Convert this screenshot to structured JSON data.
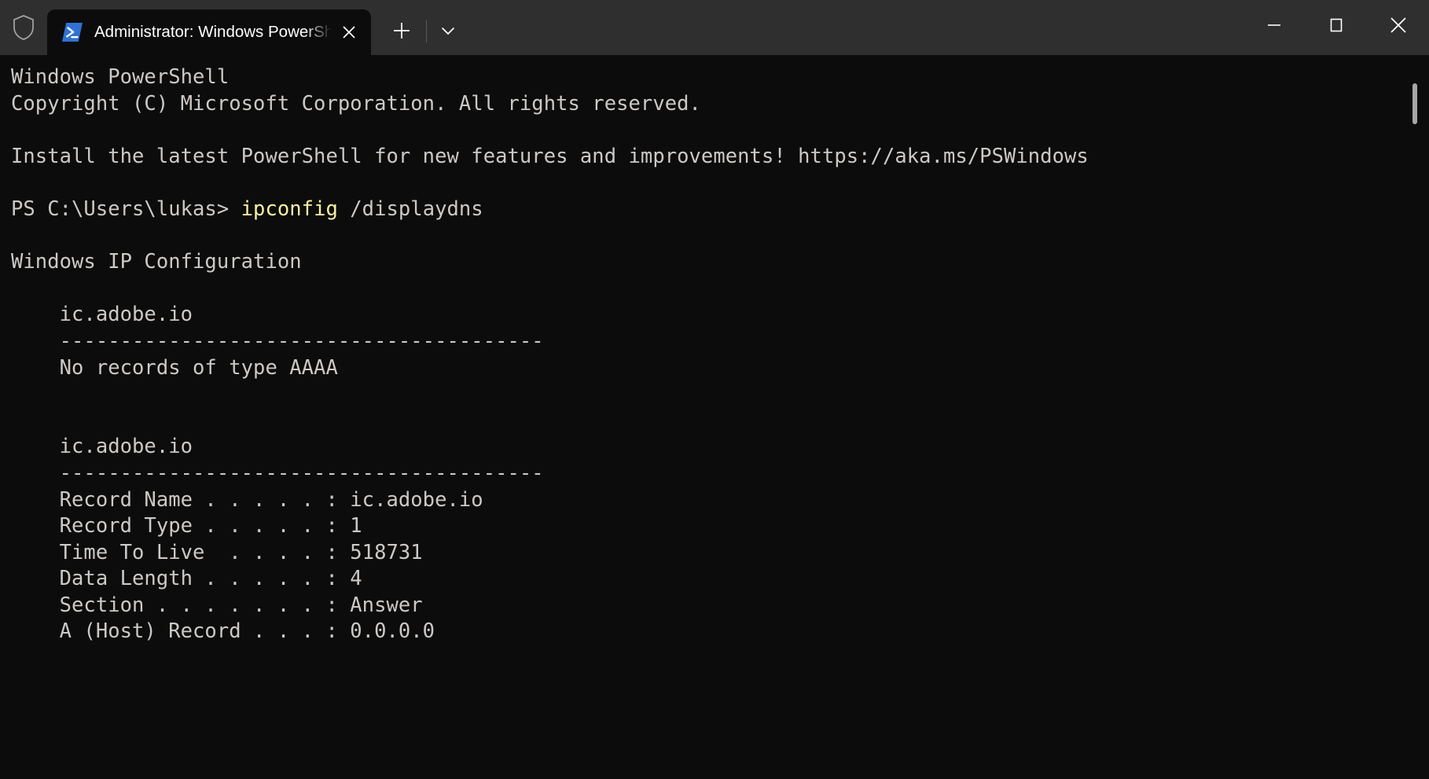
{
  "window": {
    "titlebar": {
      "shield_icon": "shield-icon",
      "minimize_label": "—",
      "maximize_label": "□",
      "close_label": "✕",
      "newtab_label": "+",
      "dropdown_label": "⌄"
    },
    "tabs": [
      {
        "icon": "powershell-icon",
        "title": "Administrator: Windows PowerShell",
        "close_label": "✕",
        "active": true
      }
    ]
  },
  "terminal": {
    "colors": {
      "background": "#0c0c0c",
      "foreground": "#ccc9c6",
      "command_accent": "#f9f1a5",
      "titlebar": "#2f2f2f"
    },
    "lines": [
      {
        "text": "Windows PowerShell"
      },
      {
        "text": "Copyright (C) Microsoft Corporation. All rights reserved."
      },
      {
        "text": ""
      },
      {
        "text": "Install the latest PowerShell for new features and improvements! https://aka.ms/PSWindows"
      },
      {
        "text": ""
      },
      {
        "prompt": "PS C:\\Users\\lukas> ",
        "command": "ipconfig",
        "args": " /displaydns"
      },
      {
        "text": ""
      },
      {
        "text": "Windows IP Configuration"
      },
      {
        "text": ""
      },
      {
        "text": "    ic.adobe.io"
      },
      {
        "text": "    ----------------------------------------"
      },
      {
        "text": "    No records of type AAAA"
      },
      {
        "text": ""
      },
      {
        "text": ""
      },
      {
        "text": "    ic.adobe.io"
      },
      {
        "text": "    ----------------------------------------"
      },
      {
        "text": "    Record Name . . . . . : ic.adobe.io"
      },
      {
        "text": "    Record Type . . . . . : 1"
      },
      {
        "text": "    Time To Live  . . . . : 518731"
      },
      {
        "text": "    Data Length . . . . . : 4"
      },
      {
        "text": "    Section . . . . . . . : Answer"
      },
      {
        "text": "    A (Host) Record . . . : 0.0.0.0"
      }
    ]
  }
}
